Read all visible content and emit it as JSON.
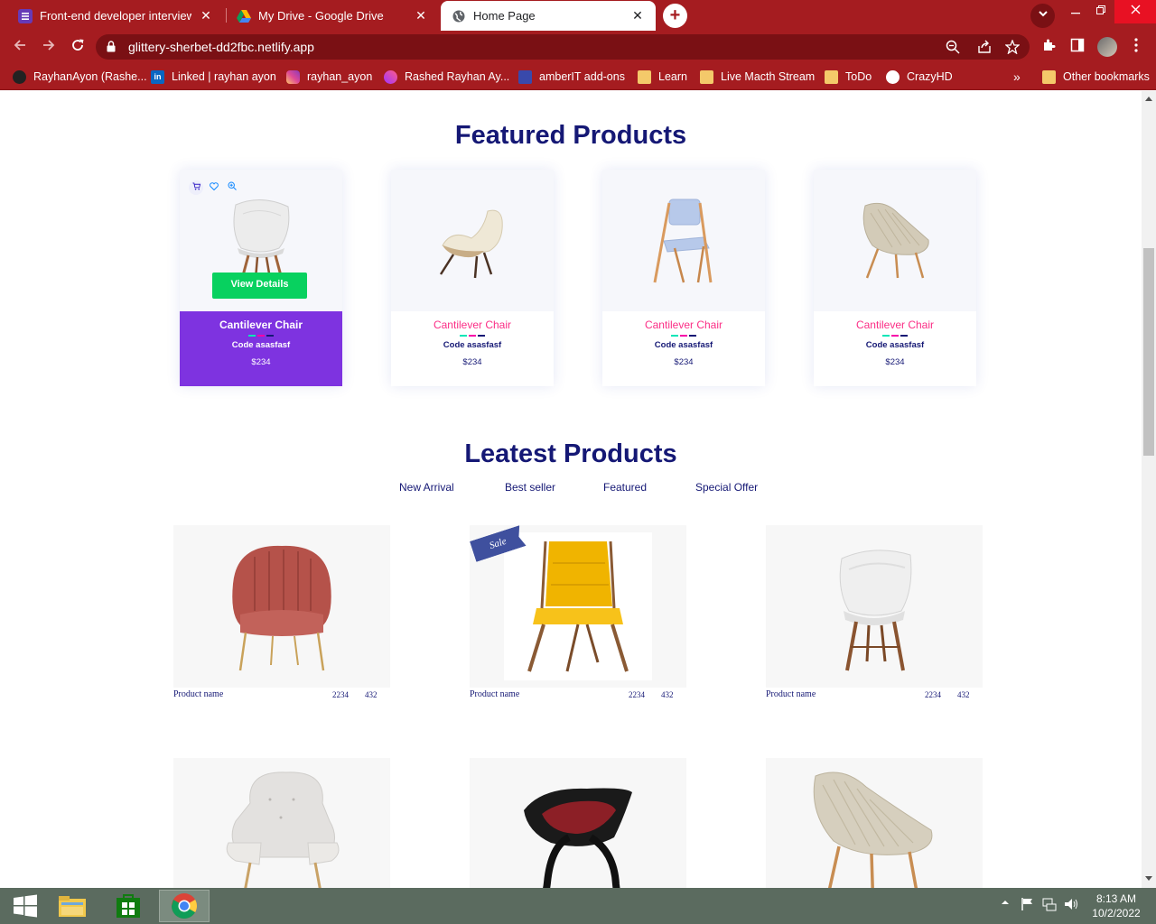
{
  "browser": {
    "tabs": [
      {
        "title": "Front-end developer interview as",
        "close": "✕"
      },
      {
        "title": "My Drive - Google Drive",
        "close": "✕"
      },
      {
        "title": "Home Page",
        "close": "✕"
      }
    ],
    "new_tab": "+",
    "url": "glittery-sherbet-dd2fbc.netlify.app",
    "bookmarks": [
      "RayhanAyon (Rashe...",
      "Linked | rayhan ayon",
      "rayhan_ayon",
      "Rashed Rayhan Ay...",
      "amberIT add-ons",
      "Learn",
      "Live Macth Stream",
      "ToDo",
      "CrazyHD"
    ],
    "more_bookmarks": "»",
    "other_bookmarks": "Other bookmarks"
  },
  "featured": {
    "title": "Featured Products",
    "view_details": "View Details",
    "cards": [
      {
        "name": "Cantilever Chair",
        "code": "Code asasfasf",
        "price": "$234"
      },
      {
        "name": "Cantilever Chair",
        "code": "Code asasfasf",
        "price": "$234"
      },
      {
        "name": "Cantilever Chair",
        "code": "Code asasfasf",
        "price": "$234"
      },
      {
        "name": "Cantilever Chair",
        "code": "Code asasfasf",
        "price": "$234"
      }
    ]
  },
  "latest": {
    "title": "Leatest Products",
    "tabs": [
      "New Arrival",
      "Best seller",
      "Featured",
      "Special Offer"
    ],
    "sale_label": "Sale",
    "cards": [
      {
        "name": "Product name",
        "price": "2234",
        "old_price": "432"
      },
      {
        "name": "Product name",
        "price": "2234",
        "old_price": "432"
      },
      {
        "name": "Product name",
        "price": "2234",
        "old_price": "432"
      }
    ]
  },
  "taskbar": {
    "time": "8:13 AM",
    "date": "10/2/2022"
  },
  "colors": {
    "browser_frame": "#a51c20",
    "heading": "#151875",
    "accent_pink": "#fb2e86",
    "highlight_purple": "#7e33e0",
    "button_green": "#08d15f"
  }
}
